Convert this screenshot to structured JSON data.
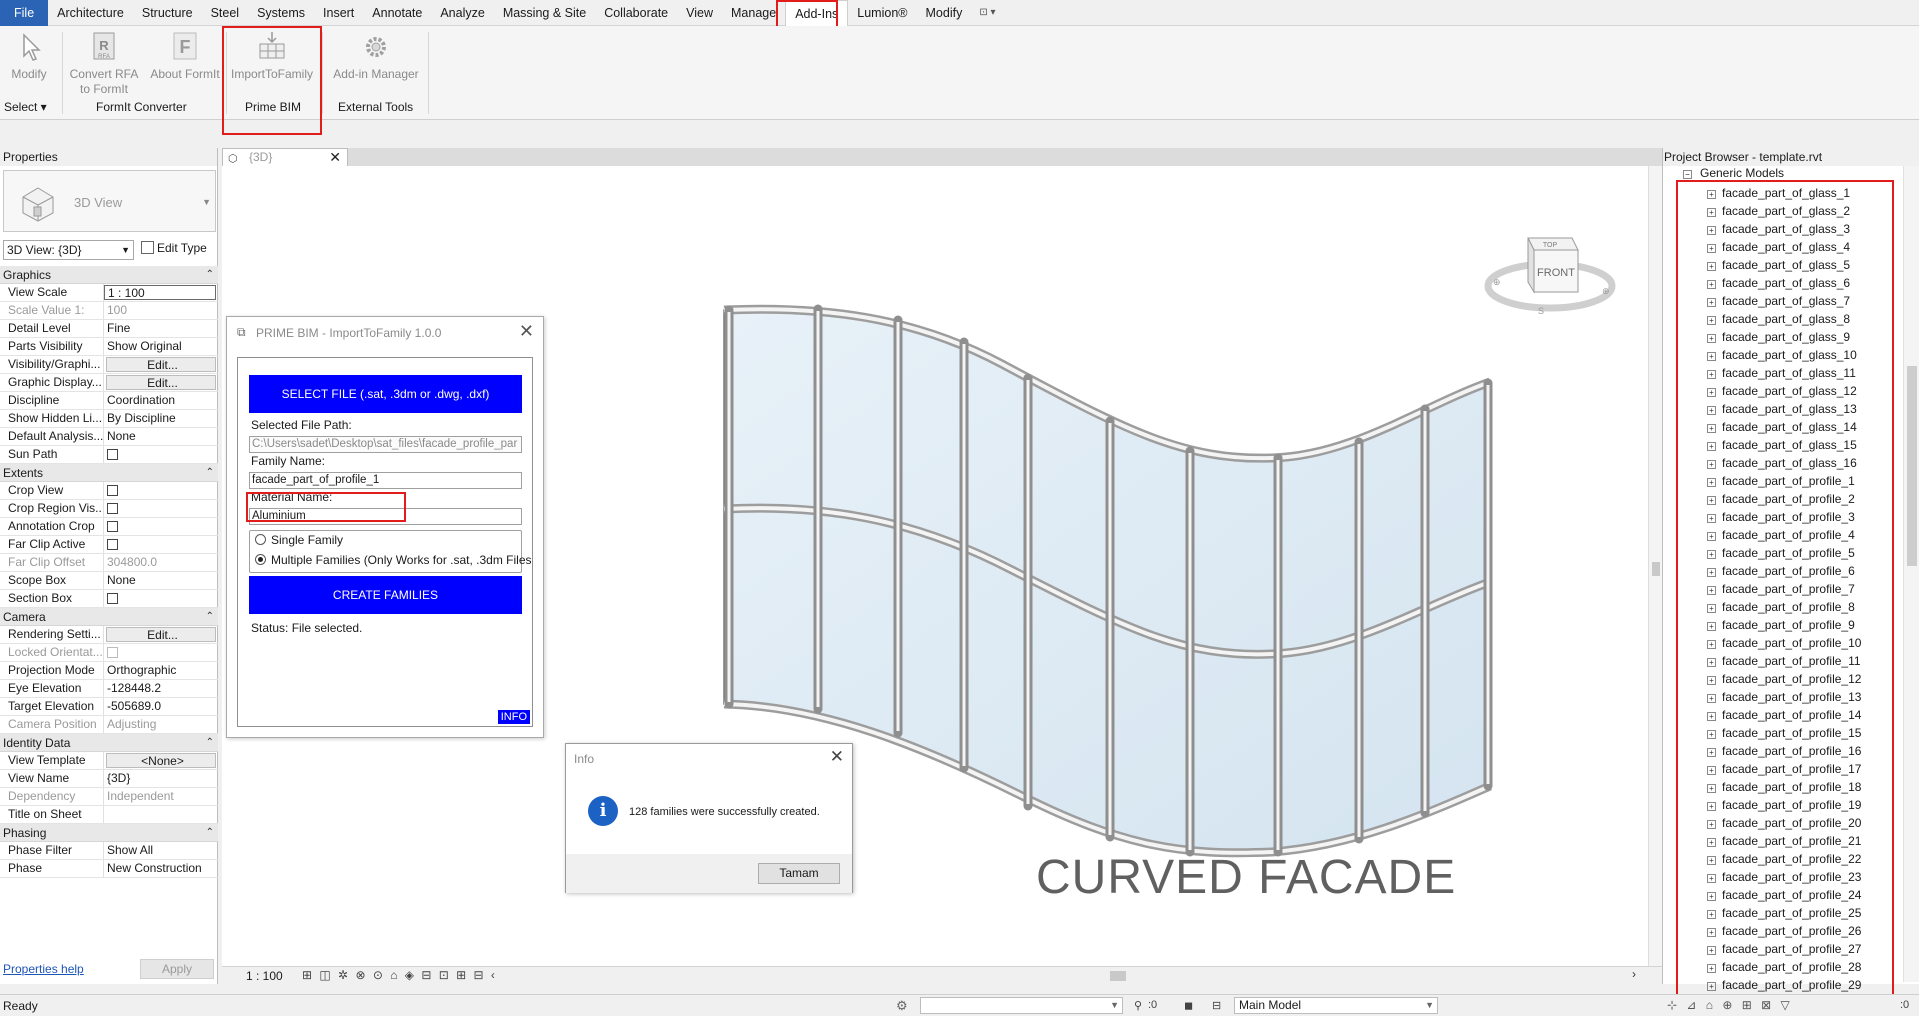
{
  "menu": {
    "tabs": [
      "File",
      "Architecture",
      "Structure",
      "Steel",
      "Systems",
      "Insert",
      "Annotate",
      "Analyze",
      "Massing & Site",
      "Collaborate",
      "View",
      "Manage",
      "Add-Ins",
      "Lumion®",
      "Modify"
    ],
    "active_tab": "Add-Ins",
    "qat_label": "⊡ ▾"
  },
  "ribbon": {
    "modify": {
      "label": "Modify"
    },
    "select": {
      "label": "Select ▾"
    },
    "convert_rfa": {
      "label": "Convert RFA to FormIt"
    },
    "about_formit": {
      "label": "About FormIt"
    },
    "formit_panel": "FormIt Converter",
    "import_to_family": {
      "label": "ImportToFamily"
    },
    "prime_panel": "Prime BIM",
    "addin_manager": {
      "label": "Add-in Manager"
    },
    "external_panel": "External Tools"
  },
  "properties": {
    "title": "Properties",
    "type_name": "3D View",
    "view_selector": "3D View: {3D}",
    "edit_type": "Edit Type",
    "sections": {
      "graphics": "Graphics",
      "extents": "Extents",
      "camera": "Camera",
      "identity": "Identity Data",
      "phasing": "Phasing"
    },
    "graphics": [
      {
        "k": "View Scale",
        "v": "1 : 100"
      },
      {
        "k": "Scale Value    1:",
        "v": "100"
      },
      {
        "k": "Detail Level",
        "v": "Fine"
      },
      {
        "k": "Parts Visibility",
        "v": "Show Original"
      },
      {
        "k": "Visibility/Graphi...",
        "v": "Edit..."
      },
      {
        "k": "Graphic Display...",
        "v": "Edit..."
      },
      {
        "k": "Discipline",
        "v": "Coordination"
      },
      {
        "k": "Show Hidden Li...",
        "v": "By Discipline"
      },
      {
        "k": "Default Analysis...",
        "v": "None"
      },
      {
        "k": "Sun Path",
        "v": ""
      }
    ],
    "extents": [
      {
        "k": "Crop View",
        "v": ""
      },
      {
        "k": "Crop Region Vis...",
        "v": ""
      },
      {
        "k": "Annotation Crop",
        "v": ""
      },
      {
        "k": "Far Clip Active",
        "v": ""
      },
      {
        "k": "Far Clip Offset",
        "v": "304800.0"
      },
      {
        "k": "Scope Box",
        "v": "None"
      },
      {
        "k": "Section Box",
        "v": ""
      }
    ],
    "camera": [
      {
        "k": "Rendering Setti...",
        "v": "Edit..."
      },
      {
        "k": "Locked Orientat...",
        "v": ""
      },
      {
        "k": "Projection Mode",
        "v": "Orthographic"
      },
      {
        "k": "Eye Elevation",
        "v": "-128448.2"
      },
      {
        "k": "Target Elevation",
        "v": "-505689.0"
      },
      {
        "k": "Camera Position",
        "v": "Adjusting"
      }
    ],
    "identity": [
      {
        "k": "View Template",
        "v": "<None>"
      },
      {
        "k": "View Name",
        "v": "{3D}"
      },
      {
        "k": "Dependency",
        "v": "Independent"
      },
      {
        "k": "Title on Sheet",
        "v": ""
      }
    ],
    "phasing": [
      {
        "k": "Phase Filter",
        "v": "Show All"
      },
      {
        "k": "Phase",
        "v": "New Construction"
      }
    ],
    "help_link": "Properties help",
    "apply": "Apply"
  },
  "view": {
    "tab_label": "{3D}",
    "scale": "1 : 100",
    "title": "CURVED FACADE",
    "viewcube_top": "TOP",
    "viewcube_front": "FRONT"
  },
  "plugin": {
    "title": "PRIME BIM - ImportToFamily 1.0.0",
    "select_file_btn": "SELECT FILE (.sat, .3dm or .dwg, .dxf)",
    "selected_path_label": "Selected File Path:",
    "selected_path_value": "C:\\Users\\sadet\\Desktop\\sat_files\\facade_profile_par",
    "family_name_label": "Family Name:",
    "family_name_value": "facade_part_of_profile_1",
    "material_name_label": "Material Name:",
    "material_name_value": "Aluminium",
    "option_single": "Single Family",
    "option_multiple": "Multiple Families (Only Works for .sat, .3dm Files",
    "create_btn": "CREATE FAMILIES",
    "status": "Status: File selected.",
    "info_tag": "INFO"
  },
  "info_dialog": {
    "title": "Info",
    "message": "128 families were successfully created.",
    "ok": "Tamam"
  },
  "browser": {
    "title": "Project Browser - template.rvt",
    "root": "Generic Models",
    "items": [
      "facade_part_of_glass_1",
      "facade_part_of_glass_2",
      "facade_part_of_glass_3",
      "facade_part_of_glass_4",
      "facade_part_of_glass_5",
      "facade_part_of_glass_6",
      "facade_part_of_glass_7",
      "facade_part_of_glass_8",
      "facade_part_of_glass_9",
      "facade_part_of_glass_10",
      "facade_part_of_glass_11",
      "facade_part_of_glass_12",
      "facade_part_of_glass_13",
      "facade_part_of_glass_14",
      "facade_part_of_glass_15",
      "facade_part_of_glass_16",
      "facade_part_of_profile_1",
      "facade_part_of_profile_2",
      "facade_part_of_profile_3",
      "facade_part_of_profile_4",
      "facade_part_of_profile_5",
      "facade_part_of_profile_6",
      "facade_part_of_profile_7",
      "facade_part_of_profile_8",
      "facade_part_of_profile_9",
      "facade_part_of_profile_10",
      "facade_part_of_profile_11",
      "facade_part_of_profile_12",
      "facade_part_of_profile_13",
      "facade_part_of_profile_14",
      "facade_part_of_profile_15",
      "facade_part_of_profile_16",
      "facade_part_of_profile_17",
      "facade_part_of_profile_18",
      "facade_part_of_profile_19",
      "facade_part_of_profile_20",
      "facade_part_of_profile_21",
      "facade_part_of_profile_22",
      "facade_part_of_profile_23",
      "facade_part_of_profile_24",
      "facade_part_of_profile_25",
      "facade_part_of_profile_26",
      "facade_part_of_profile_27",
      "facade_part_of_profile_28",
      "facade_part_of_profile_29"
    ]
  },
  "status": {
    "ready": "Ready",
    "zero_a": ":0",
    "model": "Main Model",
    "zero_b": ":0"
  },
  "colors": {
    "file_tab": "#2b64b4",
    "highlight": "#e21b1b",
    "plugin_button": "#0000ff",
    "info_icon": "#1c62c4"
  }
}
